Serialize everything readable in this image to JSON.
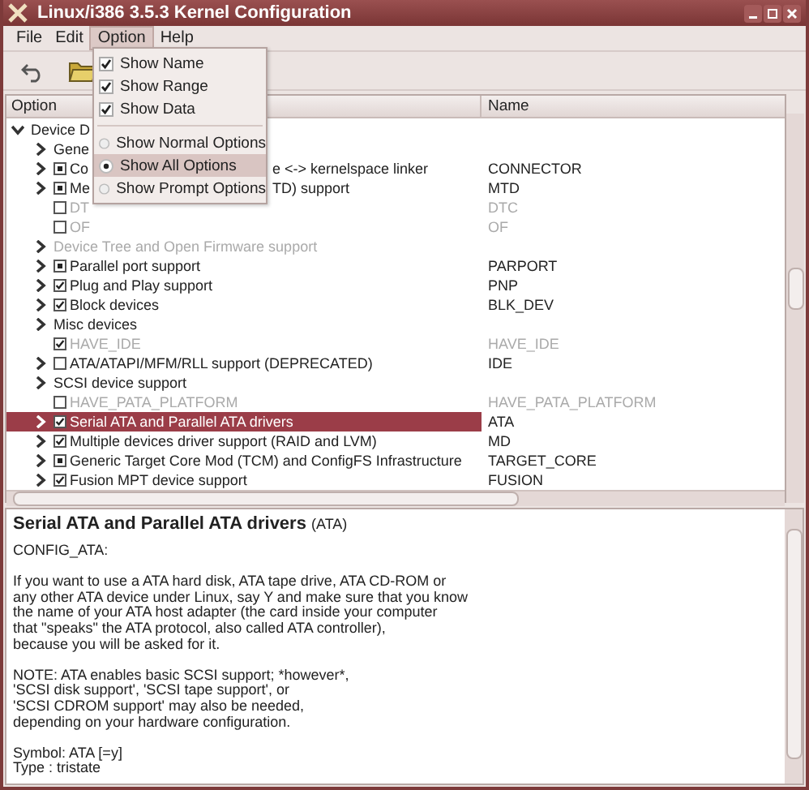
{
  "window": {
    "title": "Linux/i386 3.5.3 Kernel Configuration"
  },
  "menubar": [
    {
      "label": "File",
      "selected": false
    },
    {
      "label": "Edit",
      "selected": false
    },
    {
      "label": "Option",
      "selected": true
    },
    {
      "label": "Help",
      "selected": false
    }
  ],
  "option_menu": [
    {
      "kind": "check",
      "label": "Show Name",
      "checked": true,
      "selected": false
    },
    {
      "kind": "check",
      "label": "Show Range",
      "checked": true,
      "selected": false
    },
    {
      "kind": "check",
      "label": "Show Data",
      "checked": true,
      "selected": false
    },
    {
      "kind": "radio",
      "label": "Show Normal Options",
      "checked": false,
      "selected": false
    },
    {
      "kind": "radio",
      "label": "Show All Options",
      "checked": true,
      "selected": true
    },
    {
      "kind": "radio",
      "label": "Show Prompt Options",
      "checked": false,
      "selected": false
    }
  ],
  "tree": {
    "columns": [
      "Option",
      "Name"
    ],
    "rows": [
      {
        "kind": "menu",
        "label": "Device D",
        "arrow": true,
        "expanded": true,
        "disabled": false,
        "selected": false,
        "children": [
          {
            "kind": "menu",
            "label": "Gene",
            "arrow": true,
            "expanded": false,
            "disabled": false,
            "selected": false
          },
          {
            "kind": "option",
            "checked": true,
            "module": true,
            "label": "Co",
            "label_tail": "e <-> kernelspace linker",
            "name": "CONNECTOR",
            "arrow": true,
            "expanded": false,
            "disabled": false,
            "selected": false
          },
          {
            "kind": "option",
            "checked": true,
            "module": true,
            "label": "Me",
            "label_tail": "TD) support",
            "name": "MTD",
            "arrow": true,
            "expanded": false,
            "disabled": false,
            "selected": false
          },
          {
            "kind": "option",
            "checked": false,
            "label": "DT",
            "name": "DTC",
            "arrow": false,
            "disabled": true,
            "selected": false
          },
          {
            "kind": "option",
            "checked": false,
            "label": "OF",
            "name": "OF",
            "arrow": false,
            "disabled": true,
            "selected": false
          },
          {
            "kind": "menu",
            "label": "Device Tree and Open Firmware support",
            "arrow": true,
            "expanded": false,
            "disabled": true,
            "selected": false
          },
          {
            "kind": "option",
            "checked": true,
            "module": true,
            "label": "Parallel port support",
            "name": "PARPORT",
            "arrow": true,
            "expanded": false,
            "disabled": false,
            "selected": false
          },
          {
            "kind": "option",
            "checked": true,
            "module": false,
            "label": "Plug and Play support",
            "name": "PNP",
            "arrow": true,
            "expanded": false,
            "disabled": false,
            "selected": false
          },
          {
            "kind": "option",
            "checked": true,
            "module": false,
            "label": "Block devices",
            "name": "BLK_DEV",
            "arrow": true,
            "expanded": false,
            "disabled": false,
            "selected": false
          },
          {
            "kind": "menu",
            "label": "Misc devices",
            "arrow": true,
            "expanded": false,
            "disabled": false,
            "selected": false
          },
          {
            "kind": "option",
            "checked": true,
            "module": false,
            "label": "HAVE_IDE",
            "name": "HAVE_IDE",
            "arrow": false,
            "disabled": true,
            "selected": false
          },
          {
            "kind": "option",
            "checked": false,
            "label": "ATA/ATAPI/MFM/RLL support (DEPRECATED)",
            "name": "IDE",
            "arrow": true,
            "expanded": false,
            "disabled": false,
            "selected": false
          },
          {
            "kind": "menu",
            "label": "SCSI device support",
            "arrow": true,
            "expanded": false,
            "disabled": false,
            "selected": false
          },
          {
            "kind": "option",
            "checked": false,
            "label": "HAVE_PATA_PLATFORM",
            "name": "HAVE_PATA_PLATFORM",
            "arrow": false,
            "disabled": true,
            "selected": false
          },
          {
            "kind": "option",
            "checked": true,
            "module": false,
            "label": "Serial ATA and Parallel ATA drivers",
            "name": "ATA",
            "arrow": true,
            "expanded": false,
            "disabled": false,
            "selected": true
          },
          {
            "kind": "option",
            "checked": true,
            "module": false,
            "label": "Multiple devices driver support (RAID and LVM)",
            "name": "MD",
            "arrow": true,
            "expanded": false,
            "disabled": false,
            "selected": false
          },
          {
            "kind": "option",
            "checked": true,
            "module": true,
            "label": "Generic Target Core Mod (TCM) and ConfigFS Infrastructure",
            "name": "TARGET_CORE",
            "arrow": true,
            "expanded": false,
            "disabled": false,
            "selected": false
          },
          {
            "kind": "option",
            "checked": true,
            "module": false,
            "label": "Fusion MPT device support",
            "name": "FUSION",
            "arrow": true,
            "expanded": false,
            "disabled": false,
            "selected": false
          }
        ]
      }
    ]
  },
  "help": {
    "title": "Serial ATA and Parallel ATA drivers",
    "symbol": "(ATA)",
    "paragraphs": [
      "CONFIG_ATA:",
      "If you want to use a ATA hard disk, ATA tape drive, ATA CD-ROM or\nany other ATA device under Linux, say Y and make sure that you know\nthe name of your ATA host adapter (the card inside your computer\nthat \"speaks\" the ATA protocol, also called ATA controller),\nbecause you will be asked for it.",
      "NOTE: ATA enables basic SCSI support; *however*,\n'SCSI disk support', 'SCSI tape support', or\n'SCSI CDROM support' may also be needed,\ndepending on your hardware configuration.",
      "Symbol: ATA [=y]\nType : tristate"
    ]
  }
}
